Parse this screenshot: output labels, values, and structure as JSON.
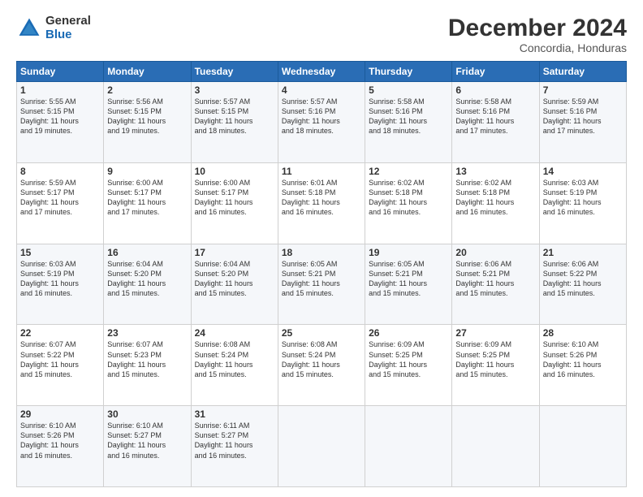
{
  "logo": {
    "general": "General",
    "blue": "Blue"
  },
  "title": "December 2024",
  "location": "Concordia, Honduras",
  "headers": [
    "Sunday",
    "Monday",
    "Tuesday",
    "Wednesday",
    "Thursday",
    "Friday",
    "Saturday"
  ],
  "weeks": [
    [
      {
        "day": "1",
        "lines": [
          "Sunrise: 5:55 AM",
          "Sunset: 5:15 PM",
          "Daylight: 11 hours",
          "and 19 minutes."
        ]
      },
      {
        "day": "2",
        "lines": [
          "Sunrise: 5:56 AM",
          "Sunset: 5:15 PM",
          "Daylight: 11 hours",
          "and 19 minutes."
        ]
      },
      {
        "day": "3",
        "lines": [
          "Sunrise: 5:57 AM",
          "Sunset: 5:15 PM",
          "Daylight: 11 hours",
          "and 18 minutes."
        ]
      },
      {
        "day": "4",
        "lines": [
          "Sunrise: 5:57 AM",
          "Sunset: 5:16 PM",
          "Daylight: 11 hours",
          "and 18 minutes."
        ]
      },
      {
        "day": "5",
        "lines": [
          "Sunrise: 5:58 AM",
          "Sunset: 5:16 PM",
          "Daylight: 11 hours",
          "and 18 minutes."
        ]
      },
      {
        "day": "6",
        "lines": [
          "Sunrise: 5:58 AM",
          "Sunset: 5:16 PM",
          "Daylight: 11 hours",
          "and 17 minutes."
        ]
      },
      {
        "day": "7",
        "lines": [
          "Sunrise: 5:59 AM",
          "Sunset: 5:16 PM",
          "Daylight: 11 hours",
          "and 17 minutes."
        ]
      }
    ],
    [
      {
        "day": "8",
        "lines": [
          "Sunrise: 5:59 AM",
          "Sunset: 5:17 PM",
          "Daylight: 11 hours",
          "and 17 minutes."
        ]
      },
      {
        "day": "9",
        "lines": [
          "Sunrise: 6:00 AM",
          "Sunset: 5:17 PM",
          "Daylight: 11 hours",
          "and 17 minutes."
        ]
      },
      {
        "day": "10",
        "lines": [
          "Sunrise: 6:00 AM",
          "Sunset: 5:17 PM",
          "Daylight: 11 hours",
          "and 16 minutes."
        ]
      },
      {
        "day": "11",
        "lines": [
          "Sunrise: 6:01 AM",
          "Sunset: 5:18 PM",
          "Daylight: 11 hours",
          "and 16 minutes."
        ]
      },
      {
        "day": "12",
        "lines": [
          "Sunrise: 6:02 AM",
          "Sunset: 5:18 PM",
          "Daylight: 11 hours",
          "and 16 minutes."
        ]
      },
      {
        "day": "13",
        "lines": [
          "Sunrise: 6:02 AM",
          "Sunset: 5:18 PM",
          "Daylight: 11 hours",
          "and 16 minutes."
        ]
      },
      {
        "day": "14",
        "lines": [
          "Sunrise: 6:03 AM",
          "Sunset: 5:19 PM",
          "Daylight: 11 hours",
          "and 16 minutes."
        ]
      }
    ],
    [
      {
        "day": "15",
        "lines": [
          "Sunrise: 6:03 AM",
          "Sunset: 5:19 PM",
          "Daylight: 11 hours",
          "and 16 minutes."
        ]
      },
      {
        "day": "16",
        "lines": [
          "Sunrise: 6:04 AM",
          "Sunset: 5:20 PM",
          "Daylight: 11 hours",
          "and 15 minutes."
        ]
      },
      {
        "day": "17",
        "lines": [
          "Sunrise: 6:04 AM",
          "Sunset: 5:20 PM",
          "Daylight: 11 hours",
          "and 15 minutes."
        ]
      },
      {
        "day": "18",
        "lines": [
          "Sunrise: 6:05 AM",
          "Sunset: 5:21 PM",
          "Daylight: 11 hours",
          "and 15 minutes."
        ]
      },
      {
        "day": "19",
        "lines": [
          "Sunrise: 6:05 AM",
          "Sunset: 5:21 PM",
          "Daylight: 11 hours",
          "and 15 minutes."
        ]
      },
      {
        "day": "20",
        "lines": [
          "Sunrise: 6:06 AM",
          "Sunset: 5:21 PM",
          "Daylight: 11 hours",
          "and 15 minutes."
        ]
      },
      {
        "day": "21",
        "lines": [
          "Sunrise: 6:06 AM",
          "Sunset: 5:22 PM",
          "Daylight: 11 hours",
          "and 15 minutes."
        ]
      }
    ],
    [
      {
        "day": "22",
        "lines": [
          "Sunrise: 6:07 AM",
          "Sunset: 5:22 PM",
          "Daylight: 11 hours",
          "and 15 minutes."
        ]
      },
      {
        "day": "23",
        "lines": [
          "Sunrise: 6:07 AM",
          "Sunset: 5:23 PM",
          "Daylight: 11 hours",
          "and 15 minutes."
        ]
      },
      {
        "day": "24",
        "lines": [
          "Sunrise: 6:08 AM",
          "Sunset: 5:24 PM",
          "Daylight: 11 hours",
          "and 15 minutes."
        ]
      },
      {
        "day": "25",
        "lines": [
          "Sunrise: 6:08 AM",
          "Sunset: 5:24 PM",
          "Daylight: 11 hours",
          "and 15 minutes."
        ]
      },
      {
        "day": "26",
        "lines": [
          "Sunrise: 6:09 AM",
          "Sunset: 5:25 PM",
          "Daylight: 11 hours",
          "and 15 minutes."
        ]
      },
      {
        "day": "27",
        "lines": [
          "Sunrise: 6:09 AM",
          "Sunset: 5:25 PM",
          "Daylight: 11 hours",
          "and 15 minutes."
        ]
      },
      {
        "day": "28",
        "lines": [
          "Sunrise: 6:10 AM",
          "Sunset: 5:26 PM",
          "Daylight: 11 hours",
          "and 16 minutes."
        ]
      }
    ],
    [
      {
        "day": "29",
        "lines": [
          "Sunrise: 6:10 AM",
          "Sunset: 5:26 PM",
          "Daylight: 11 hours",
          "and 16 minutes."
        ]
      },
      {
        "day": "30",
        "lines": [
          "Sunrise: 6:10 AM",
          "Sunset: 5:27 PM",
          "Daylight: 11 hours",
          "and 16 minutes."
        ]
      },
      {
        "day": "31",
        "lines": [
          "Sunrise: 6:11 AM",
          "Sunset: 5:27 PM",
          "Daylight: 11 hours",
          "and 16 minutes."
        ]
      },
      null,
      null,
      null,
      null
    ]
  ]
}
